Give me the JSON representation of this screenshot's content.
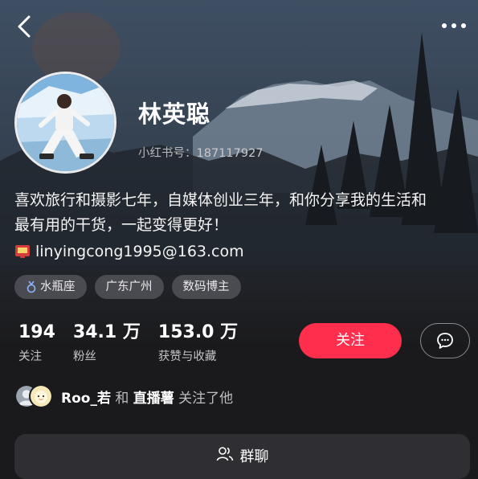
{
  "header": {
    "back_icon": "chevron-left-icon",
    "more_icon": "more-horizontal-icon"
  },
  "profile": {
    "name": "林英聪",
    "id_label": "小红书号：",
    "id_value": "187117927",
    "bio_line1": "喜欢旅行和摄影七年，自媒体创业三年，和你分享我的生活和",
    "bio_line2": "最有用的干货，一起变得更好！",
    "email": "linyingcong1995@163.com"
  },
  "tags": [
    {
      "icon": "aquarius-symbol",
      "label": "水瓶座"
    },
    {
      "label": "广东广州"
    },
    {
      "label": "数码博主"
    }
  ],
  "stats": [
    {
      "value": "194",
      "label": "关注"
    },
    {
      "value": "34.1 万",
      "label": "粉丝"
    },
    {
      "value": "153.0 万",
      "label": "获赞与收藏"
    }
  ],
  "actions": {
    "follow_label": "关注",
    "chat_icon": "message-bubble-icon"
  },
  "mutual": {
    "user1": "Roo_若",
    "connector": "和",
    "user2": "直播薯",
    "suffix": "关注了他"
  },
  "group_chat": {
    "label": "群聊",
    "icon": "group-users-icon"
  },
  "colors": {
    "accent": "#ff2e4d",
    "background": "#1a1a1c"
  }
}
